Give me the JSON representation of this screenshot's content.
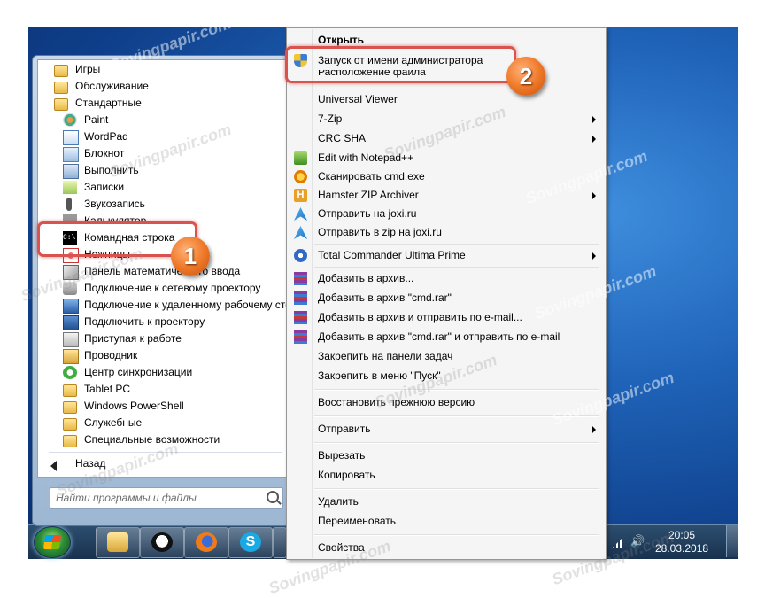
{
  "program_list": [
    {
      "label": "Игры",
      "icon": "folder-icon"
    },
    {
      "label": "Обслуживание",
      "icon": "folder-icon"
    },
    {
      "label": "Стандартные",
      "icon": "folder-icon"
    },
    {
      "label": "Paint",
      "icon": "paint-icon"
    },
    {
      "label": "WordPad",
      "icon": "wordpad-icon"
    },
    {
      "label": "Блокнот",
      "icon": "notepad-icon"
    },
    {
      "label": "Выполнить",
      "icon": "run-icon"
    },
    {
      "label": "Записки",
      "icon": "sticky-notes-icon"
    },
    {
      "label": "Звукозапись",
      "icon": "microphone-icon"
    },
    {
      "label": "Калькулятор",
      "icon": "calculator-icon"
    },
    {
      "label": "Командная строка",
      "icon": "cmd-icon"
    },
    {
      "label": "Ножницы",
      "icon": "scissors-icon"
    },
    {
      "label": "Панель математического ввода",
      "icon": "math-input-icon"
    },
    {
      "label": "Подключение к сетевому проектору",
      "icon": "network-projector-icon"
    },
    {
      "label": "Подключение к удаленному рабочему столу",
      "icon": "remote-desktop-icon"
    },
    {
      "label": "Подключить к проектору",
      "icon": "projector-icon"
    },
    {
      "label": "Приступая к работе",
      "icon": "getting-started-icon"
    },
    {
      "label": "Проводник",
      "icon": "explorer-icon"
    },
    {
      "label": "Центр синхронизации",
      "icon": "sync-center-icon"
    },
    {
      "label": "Tablet PC",
      "icon": "folder-icon"
    },
    {
      "label": "Windows PowerShell",
      "icon": "folder-icon"
    },
    {
      "label": "Служебные",
      "icon": "folder-icon"
    },
    {
      "label": "Специальные возможности",
      "icon": "folder-icon"
    }
  ],
  "back_label": "Назад",
  "search": {
    "placeholder": "Найти программы и файлы"
  },
  "context_menu": [
    {
      "label": "Открыть",
      "bold": true
    },
    {
      "label": "Запуск от имени администратора",
      "icon": "uac-shield-icon"
    },
    {
      "label": "Расположение файла"
    },
    {
      "label": "Universal Viewer"
    },
    {
      "label": "7-Zip",
      "submenu": true
    },
    {
      "label": "CRC SHA",
      "submenu": true
    },
    {
      "label": "Edit with Notepad++",
      "icon": "notepad-plus-icon"
    },
    {
      "label": "Сканировать cmd.exe",
      "icon": "antivirus-icon"
    },
    {
      "label": "Hamster ZIP Archiver",
      "icon": "hamster-icon",
      "submenu": true
    },
    {
      "label": "Отправить на joxi.ru",
      "icon": "joxi-icon"
    },
    {
      "label": "Отправить в zip на joxi.ru",
      "icon": "joxi-icon"
    },
    {
      "label": "Total Commander Ultima Prime",
      "icon": "total-commander-icon",
      "submenu": true
    },
    {
      "label": "Добавить в архив...",
      "icon": "winrar-icon"
    },
    {
      "label": "Добавить в архив \"cmd.rar\"",
      "icon": "winrar-icon"
    },
    {
      "label": "Добавить в архив и отправить по e-mail...",
      "icon": "winrar-icon"
    },
    {
      "label": "Добавить в архив \"cmd.rar\" и отправить по e-mail",
      "icon": "winrar-icon"
    },
    {
      "label": "Закрепить на панели задач"
    },
    {
      "label": "Закрепить в меню \"Пуск\""
    },
    {
      "label": "Восстановить прежнюю версию"
    },
    {
      "label": "Отправить",
      "submenu": true
    },
    {
      "label": "Вырезать"
    },
    {
      "label": "Копировать"
    },
    {
      "label": "Удалить"
    },
    {
      "label": "Переименовать"
    },
    {
      "label": "Свойства"
    }
  ],
  "callouts": {
    "step1": "1",
    "step2": "2"
  },
  "tray": {
    "time": "20:05",
    "date": "28.03.2018"
  },
  "taskbar_apps": [
    "explorer-icon",
    "panda-icon",
    "firefox-icon",
    "skype-icon"
  ],
  "watermark": "Sovingpapir.com",
  "colors": {
    "highlight": "#d9534f",
    "badge": "#f07a2a",
    "desktop": "#1f63b8"
  }
}
